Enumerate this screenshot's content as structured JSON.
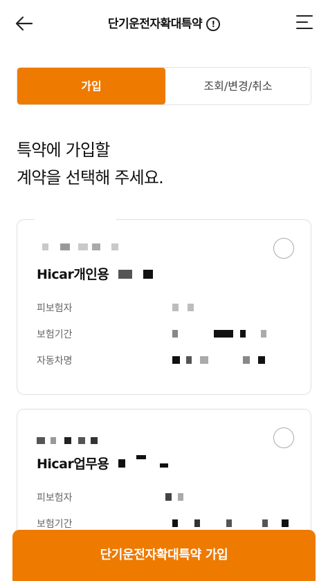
{
  "header": {
    "title": "단기운전자확대특약",
    "info_glyph": "!"
  },
  "tabs": [
    {
      "label": "가입",
      "active": true
    },
    {
      "label": "조회/변경/취소",
      "active": false
    }
  ],
  "heading": {
    "line1": "특약에 가입할",
    "line2": "계약을 선택해 주세요."
  },
  "contracts": [
    {
      "product": "Hicar개인용",
      "rows": [
        {
          "label": "피보험자"
        },
        {
          "label": "보험기간"
        },
        {
          "label": "자동차명"
        }
      ]
    },
    {
      "product": "Hicar업무용",
      "rows": [
        {
          "label": "피보험자"
        },
        {
          "label": "보험기간"
        }
      ]
    }
  ],
  "cta": {
    "label": "단기운전자확대특약 가입"
  },
  "colors": {
    "accent": "#ee7a00",
    "border": "#dedede"
  }
}
